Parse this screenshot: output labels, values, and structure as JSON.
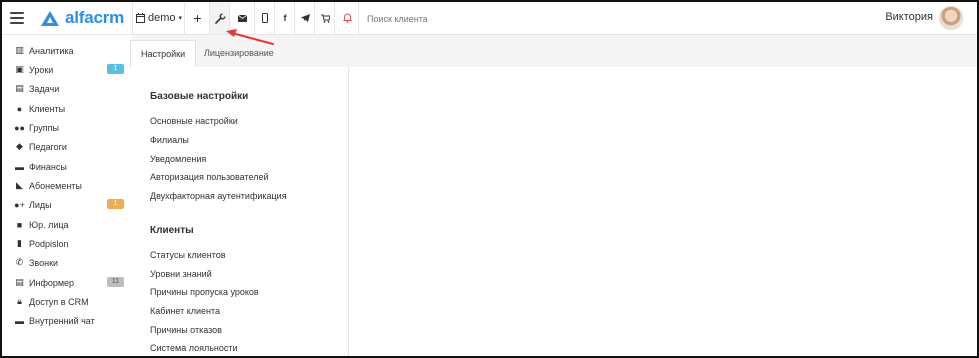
{
  "header": {
    "logo_text": "alfacrm",
    "branch_label": "demo",
    "search_placeholder": "Поиск клиента",
    "user_name": "Виктория",
    "icons": [
      "menu-icon",
      "calendar-icon",
      "caret-down-icon",
      "plus-icon",
      "wrench-icon",
      "mail-icon",
      "phone-icon",
      "facebook-icon",
      "telegram-icon",
      "cart-icon",
      "bell-icon"
    ],
    "accent_color": "#2f8de4",
    "alert_color": "#e64a4a"
  },
  "sidebar": {
    "items": [
      {
        "label": "Аналитика"
      },
      {
        "label": "Уроки",
        "badge": "1",
        "badge_color": "#5bc0de"
      },
      {
        "label": "Задачи"
      },
      {
        "label": "Клиенты"
      },
      {
        "label": "Группы"
      },
      {
        "label": "Педагоги"
      },
      {
        "label": "Финансы"
      },
      {
        "label": "Абонементы"
      },
      {
        "label": "Лиды",
        "badge": "1",
        "badge_color": "#f0ad4e"
      },
      {
        "label": "Юр. лица"
      },
      {
        "label": "Podpislon"
      },
      {
        "label": "Звонки"
      },
      {
        "label": "Информер",
        "badge": "11",
        "badge_color": "#bdbdbd"
      },
      {
        "label": "Доступ в CRM"
      },
      {
        "label": "Внутренний чат"
      }
    ]
  },
  "tabs": [
    {
      "label": "Настройки",
      "active": true
    },
    {
      "label": "Лицензирование",
      "active": false
    }
  ],
  "settings": {
    "sections": [
      {
        "title": "Базовые настройки",
        "links": [
          "Основные настройки",
          "Филиалы",
          "Уведомления",
          "Авторизация пользователей",
          "Двухфакторная аутентификация"
        ]
      },
      {
        "title": "Клиенты",
        "links": [
          "Статусы клиентов",
          "Уровни знаний",
          "Причины пропуска уроков",
          "Кабинет клиента",
          "Причины отказов",
          "Система лояльности"
        ]
      }
    ]
  },
  "annotation": {
    "arrow_color": "#e53935"
  }
}
